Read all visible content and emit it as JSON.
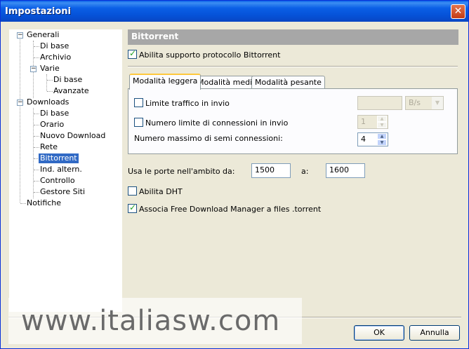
{
  "window": {
    "title": "Impostazioni"
  },
  "tree": {
    "generali": "Generali",
    "di_base_1": "Di base",
    "archivio": "Archivio",
    "varie": "Varie",
    "di_base_2": "Di base",
    "avanzate": "Avanzate",
    "downloads": "Downloads",
    "di_base_3": "Di base",
    "orario": "Orario",
    "nuovo_download": "Nuovo Download",
    "rete": "Rete",
    "bittorrent": "Bittorrent",
    "ind_altern": "Ind. altern.",
    "controllo": "Controllo",
    "gestore_siti": "Gestore Siti",
    "notifiche": "Notifiche",
    "expander_symbol": "−"
  },
  "panel": {
    "header": "Bittorrent",
    "enable_protocol": {
      "label": "Abilita supporto protocollo Bittorrent",
      "checked": true
    },
    "tabs": [
      {
        "label": "Modalità leggera",
        "active": true
      },
      {
        "label": "Modalità media",
        "active": false
      },
      {
        "label": "Modalità pesante",
        "active": false
      }
    ],
    "upload_limit": {
      "label": "Limite traffico in invio",
      "checked": false,
      "value": "",
      "unit": "B/s"
    },
    "upload_connections": {
      "label": "Numero limite di connessioni in invio",
      "checked": false,
      "value": "1"
    },
    "half_connections": {
      "label": "Numero massimo di semi connessioni:",
      "value": "4"
    },
    "port_range": {
      "label": "Usa le porte nell'ambito da:",
      "from": "1500",
      "to_label": "a:",
      "to": "1600"
    },
    "dht": {
      "label": "Abilita DHT",
      "checked": false
    },
    "associate": {
      "label": "Associa Free Download Manager a files .torrent",
      "checked": true
    }
  },
  "buttons": {
    "ok": "OK",
    "cancel": "Annulla"
  },
  "watermark": "www.italiasw.com",
  "icons": {
    "close": "close-icon",
    "check": "check-icon",
    "spin_up": "▲",
    "spin_down": "▼",
    "dropdown": "▼"
  },
  "colors": {
    "titlebar": "#0552d8",
    "selected": "#316ac5",
    "header": "#a7a7a7",
    "check": "#21a121"
  }
}
